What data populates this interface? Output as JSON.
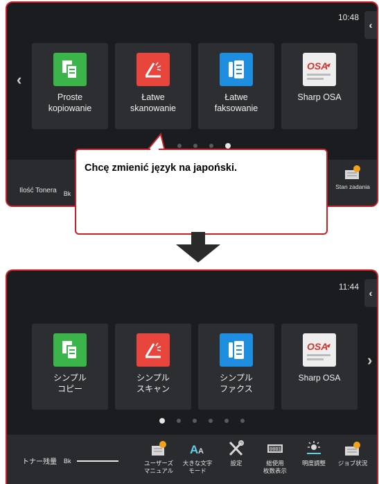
{
  "top_screen": {
    "time": "10:48",
    "tiles": [
      {
        "label": "Proste\nkopiowanie",
        "icon": "copy-icon"
      },
      {
        "label": "Łatwe\nskanowanie",
        "icon": "scan-icon"
      },
      {
        "label": "Łatwe\nfaksowanie",
        "icon": "fax-icon"
      },
      {
        "label": "Sharp OSA",
        "icon": "sharp-osa-icon"
      }
    ],
    "page_indicator": {
      "count": 4,
      "active": 4
    },
    "toner_label": "Ilość Tonera",
    "toner_color": "Bk",
    "job_status_label": "Stan zadania"
  },
  "callout": {
    "text": "Chcę zmienić język na japoński."
  },
  "bottom_screen": {
    "time": "11:44",
    "tiles": [
      {
        "label": "シンプル\nコピー",
        "icon": "copy-icon"
      },
      {
        "label": "シンプル\nスキャン",
        "icon": "scan-icon"
      },
      {
        "label": "シンプル\nファクス",
        "icon": "fax-icon"
      },
      {
        "label": "Sharp OSA",
        "icon": "sharp-osa-icon"
      }
    ],
    "page_indicator": {
      "count": 6,
      "active": 1
    },
    "toner_label": "トナー残量",
    "toner_color": "Bk",
    "bar_buttons": [
      {
        "label": "ユーザーズ\nマニュアル",
        "icon": "manual-icon"
      },
      {
        "label": "大きな文字\nモード",
        "icon": "large-text-icon"
      },
      {
        "label": "設定",
        "icon": "settings-icon"
      },
      {
        "label": "総使用\n枚数表示",
        "icon": "counter-icon"
      },
      {
        "label": "明度調整",
        "icon": "brightness-icon"
      },
      {
        "label": "ジョブ状況",
        "icon": "job-status-icon"
      }
    ]
  },
  "colors": {
    "frame_border": "#cc1f24",
    "screen_bg": "#1b1c1f",
    "copy_green": "#3bb54a",
    "scan_red": "#e8453c",
    "fax_blue": "#1e8fe0"
  }
}
